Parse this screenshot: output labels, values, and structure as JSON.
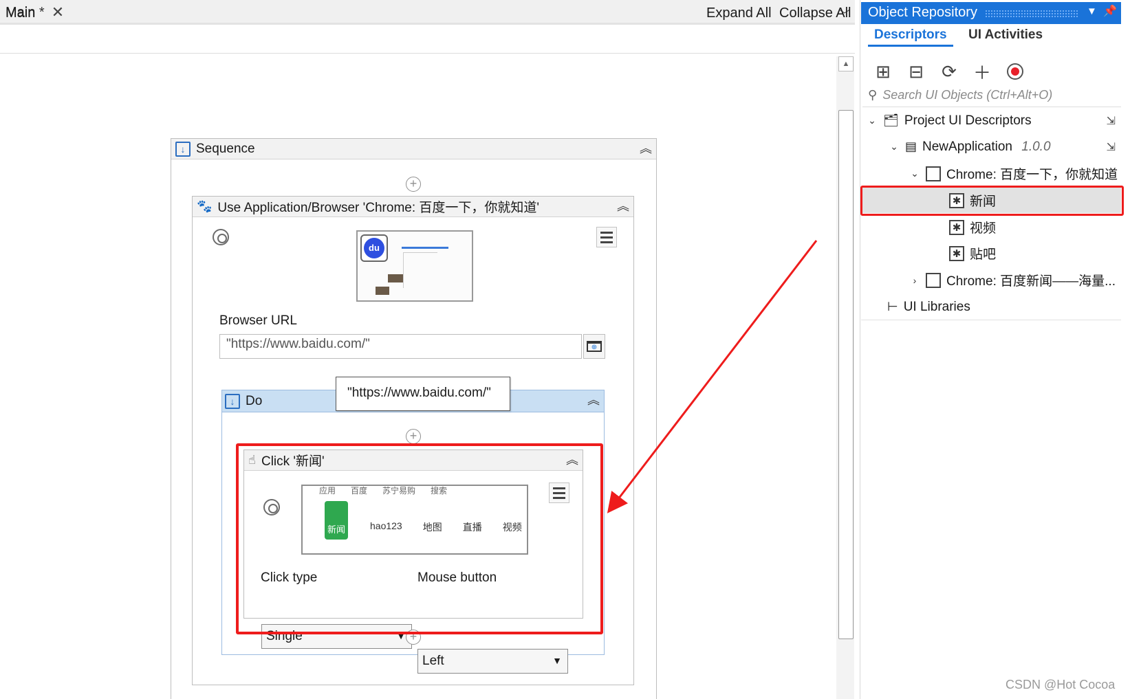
{
  "tabbar": {
    "tab_label": "Main *",
    "close_glyph": "✕",
    "dropdown_glyph": "﹀"
  },
  "breadcrumb": {
    "label": "Main",
    "expand_all": "Expand All",
    "collapse_all": "Collapse All"
  },
  "sequence": {
    "title": "Sequence",
    "icon": "sequence-icon"
  },
  "use_app": {
    "title": "Use Application/Browser 'Chrome: 百度一下，你就知道'",
    "browser_url_label": "Browser URL",
    "browser_url_value": "\"https://www.baidu.com/\"",
    "tooltip": "\"https://www.baidu.com/\""
  },
  "do_block": {
    "title": "Do"
  },
  "click_activity": {
    "title": "Click '新闻'",
    "preview_bookmarks": [
      "应用",
      "百度",
      "苏宁易购",
      "搜索"
    ],
    "preview_links": [
      "新闻",
      "hao123",
      "地图",
      "直播",
      "视频"
    ],
    "click_type_label": "Click type",
    "click_type_value": "Single",
    "mouse_button_label": "Mouse button",
    "mouse_button_value": "Left"
  },
  "right_panel": {
    "title": "Object Repository",
    "tabs": [
      "Descriptors",
      "UI Activities"
    ],
    "search_placeholder": "Search UI Objects (Ctrl+Alt+O)",
    "tree": {
      "project": "Project UI Descriptors",
      "app": "NewApplication",
      "app_version": "1.0.0",
      "screen1": "Chrome: 百度一下，你就知道",
      "elements": [
        "新闻",
        "视频",
        "贴吧"
      ],
      "screen2": "Chrome: 百度新闻——海量...",
      "libraries": "UI Libraries"
    }
  },
  "watermark": "CSDN @Hot Cocoa",
  "colors": {
    "accent": "#1a73d9",
    "highlight": "#ee1c1c",
    "do_header": "#c9dff3"
  }
}
